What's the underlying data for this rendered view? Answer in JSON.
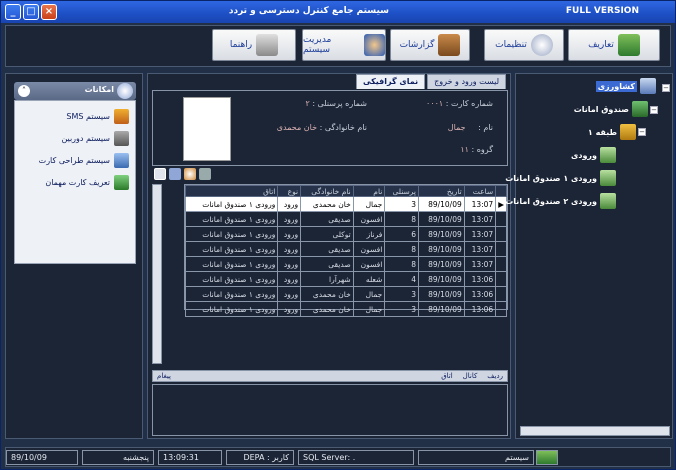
{
  "titlebar": {
    "title": "سیستم جامع کنترل دسترسی و تردد",
    "badge": "FULL VERSION",
    "min": "_",
    "max": "□",
    "close": "×"
  },
  "toolbar": {
    "definitions": "تعاریف",
    "settings": "تنظیمات",
    "reports": "گزارشات",
    "system_management": "مدیریت سیستم",
    "help": "راهنما"
  },
  "left": {
    "header": "امکانات",
    "items": [
      "سیستم SMS",
      "سیستم دوربین",
      "سیستم طراحی کارت",
      "تعریف کارت مهمان"
    ]
  },
  "center": {
    "tabs": [
      "لیست ورود و خروج",
      "نمای گرافیکی"
    ],
    "card_no_label": "شماره کارت :",
    "card_no": "۰۰۰۱",
    "personnel_no_label": "شماره پرسنلی :",
    "personnel_no": "۲",
    "name_label": "نام :",
    "name": "جمال",
    "family_label": "نام خانوادگی :",
    "family": "خان محمدی",
    "group_label": "گروه :",
    "group": "۱۱",
    "columns": [
      "ساعت",
      "تاریخ",
      "پرسنلی",
      "نام",
      "نام خانوادگی",
      "نوع",
      "اتاق"
    ],
    "rows": [
      [
        "13:07",
        "89/10/09",
        "3",
        "جمال",
        "خان محمدی",
        "ورود",
        "ورودی ۱ صندوق امانات"
      ],
      [
        "13:07",
        "89/10/09",
        "8",
        "افسون",
        "صدیقی",
        "ورود",
        "ورودی ۱ صندوق امانات"
      ],
      [
        "13:07",
        "89/10/09",
        "6",
        "فرناز",
        "توکلی",
        "ورود",
        "ورودی ۱ صندوق امانات"
      ],
      [
        "13:07",
        "89/10/09",
        "8",
        "افسون",
        "صدیقی",
        "ورود",
        "ورودی ۱ صندوق امانات"
      ],
      [
        "13:07",
        "89/10/09",
        "8",
        "افسون",
        "صدیقی",
        "ورود",
        "ورودی ۱ صندوق امانات"
      ],
      [
        "13:06",
        "89/10/09",
        "4",
        "شعله",
        "شهرآرا",
        "ورود",
        "ورودی ۱ صندوق امانات"
      ],
      [
        "13:06",
        "89/10/09",
        "3",
        "جمال",
        "خان محمدی",
        "ورود",
        "ورودی ۱ صندوق امانات"
      ],
      [
        "13:06",
        "89/10/09",
        "3",
        "جمال",
        "خان محمدی",
        "ورود",
        "ورودی ۱ صندوق امانات"
      ]
    ],
    "msg_cols": [
      "ردیف",
      "کانال",
      "اتاق",
      "پیغام"
    ]
  },
  "tree": {
    "root": "کشاورزی",
    "l1": "صندوق امانات",
    "l2": "طبقه ۱",
    "leaves": [
      "ورودی",
      "ورودی ۱ صندوق امانات",
      "ورودی ۲ صندوق امانات"
    ]
  },
  "status": {
    "date": "89/10/09",
    "weekday": "پنجشنبه",
    "time": "13:09:31",
    "user": "کاربر : DEPA",
    "sql": "SQL Server: .",
    "system": "سیستم"
  }
}
